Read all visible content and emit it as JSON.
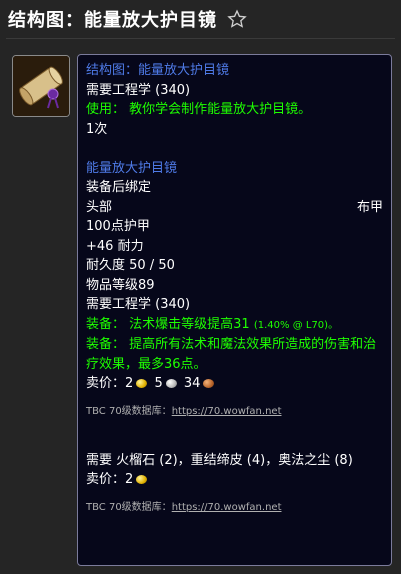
{
  "title": "结构图：能量放大护目镜",
  "icons": {
    "favorite": "star-outline-icon",
    "item": "recipe-scroll-icon",
    "gold": "gold-coin-icon",
    "silver": "silver-coin-icon",
    "copper": "copper-coin-icon"
  },
  "colors": {
    "name_blue": "#4f7be8",
    "use_green": "#1eff00",
    "background": "#252525",
    "tooltip_bg": "#06071a"
  },
  "recipe": {
    "name": "结构图：能量放大护目镜",
    "req_skill": "需要工程学 (340)",
    "use_text": "使用： 教你学会制作能量放大护目镜。",
    "charges": "1次"
  },
  "item": {
    "name": "能量放大护目镜",
    "bind": "装备后绑定",
    "slot": "头部",
    "armor_type": "布甲",
    "armor": "100点护甲",
    "stamina": "+46 耐力",
    "durability": "耐久度 50 / 50",
    "item_level": "物品等级89",
    "req_skill": "需要工程学 (340)",
    "equip1_label": "装备：",
    "equip1_text": "法术爆击等级提高31",
    "equip1_note": "(1.40% @ L70)。",
    "equip2_label": "装备：",
    "equip2_text": "提高所有法术和魔法效果所造成的伤害和治疗效果，最多36点。",
    "sell_label": "卖价：",
    "sell_gold": "2",
    "sell_silver": "5",
    "sell_copper": "34",
    "source_label": "TBC 70级数据库：",
    "source_link": "https://70.wowfan.net"
  },
  "reagents": {
    "text": "需要 火榴石 (2)，重结缔皮 (4)，奥法之尘 (8)",
    "sell_label": "卖价：",
    "sell_gold": "2",
    "source_label": "TBC 70级数据库：",
    "source_link": "https://70.wowfan.net"
  }
}
